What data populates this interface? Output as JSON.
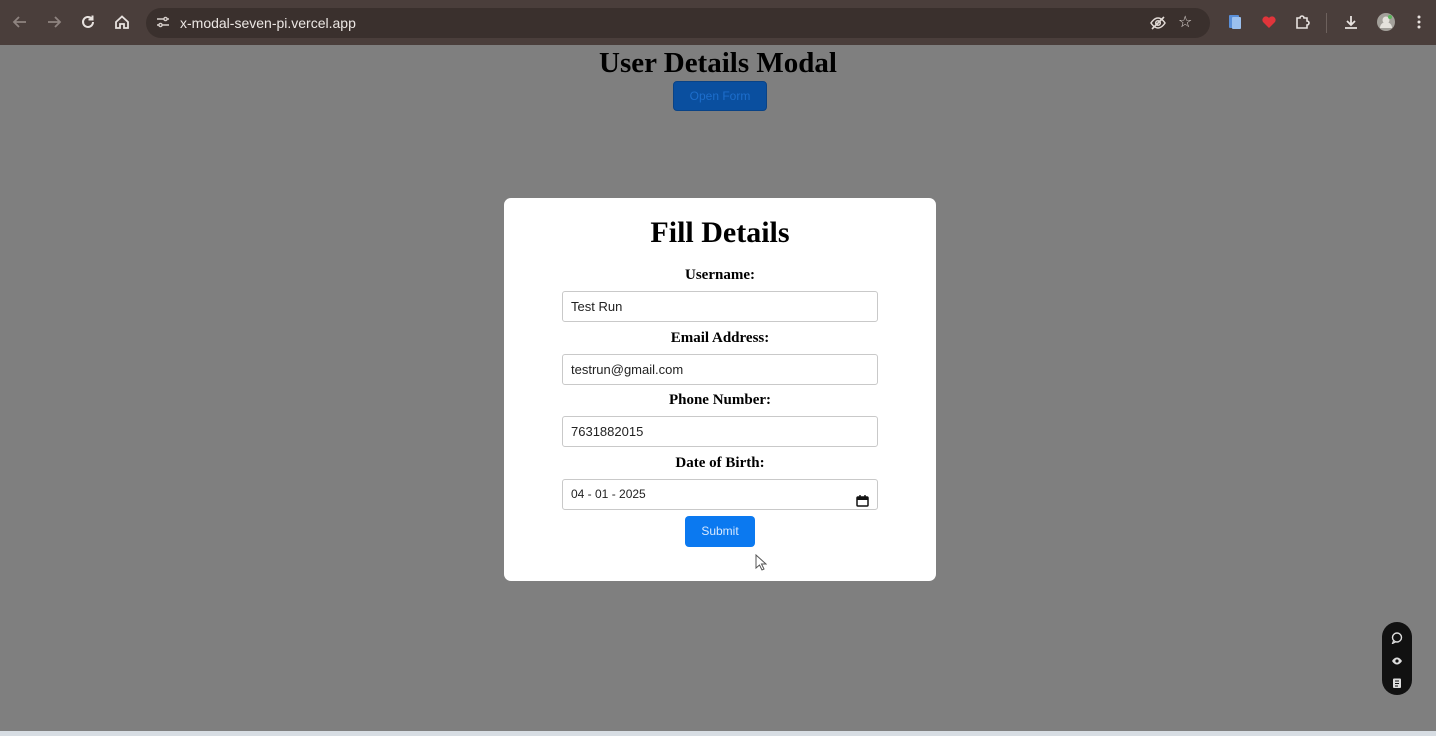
{
  "browser": {
    "url": "x-modal-seven-pi.vercel.app",
    "icons": [
      "back-arrow-icon",
      "forward-arrow-icon",
      "reload-icon",
      "home-icon",
      "site-settings-icon",
      "eye-off-icon",
      "bookmark-star-icon",
      "extension-icon",
      "heart-extension-icon",
      "puzzle-extensions-icon",
      "download-icon",
      "profile-avatar-icon",
      "kebab-menu-icon"
    ]
  },
  "page": {
    "title": "User Details Modal",
    "open_form_label": "Open Form"
  },
  "modal": {
    "title": "Fill Details",
    "fields": [
      {
        "label": "Username:",
        "value": "Test Run"
      },
      {
        "label": "Email Address:",
        "value": "testrun@gmail.com"
      },
      {
        "label": "Phone Number:",
        "value": "7631882015"
      },
      {
        "label": "Date of Birth:",
        "value": "04 - 01 - 2025"
      }
    ],
    "submit_label": "Submit"
  },
  "colors": {
    "overlay": "#7f7f7f",
    "browser_bar": "#4a3e3b",
    "submit_blue": "#0b79f0",
    "modal_bg": "#ffffff"
  }
}
